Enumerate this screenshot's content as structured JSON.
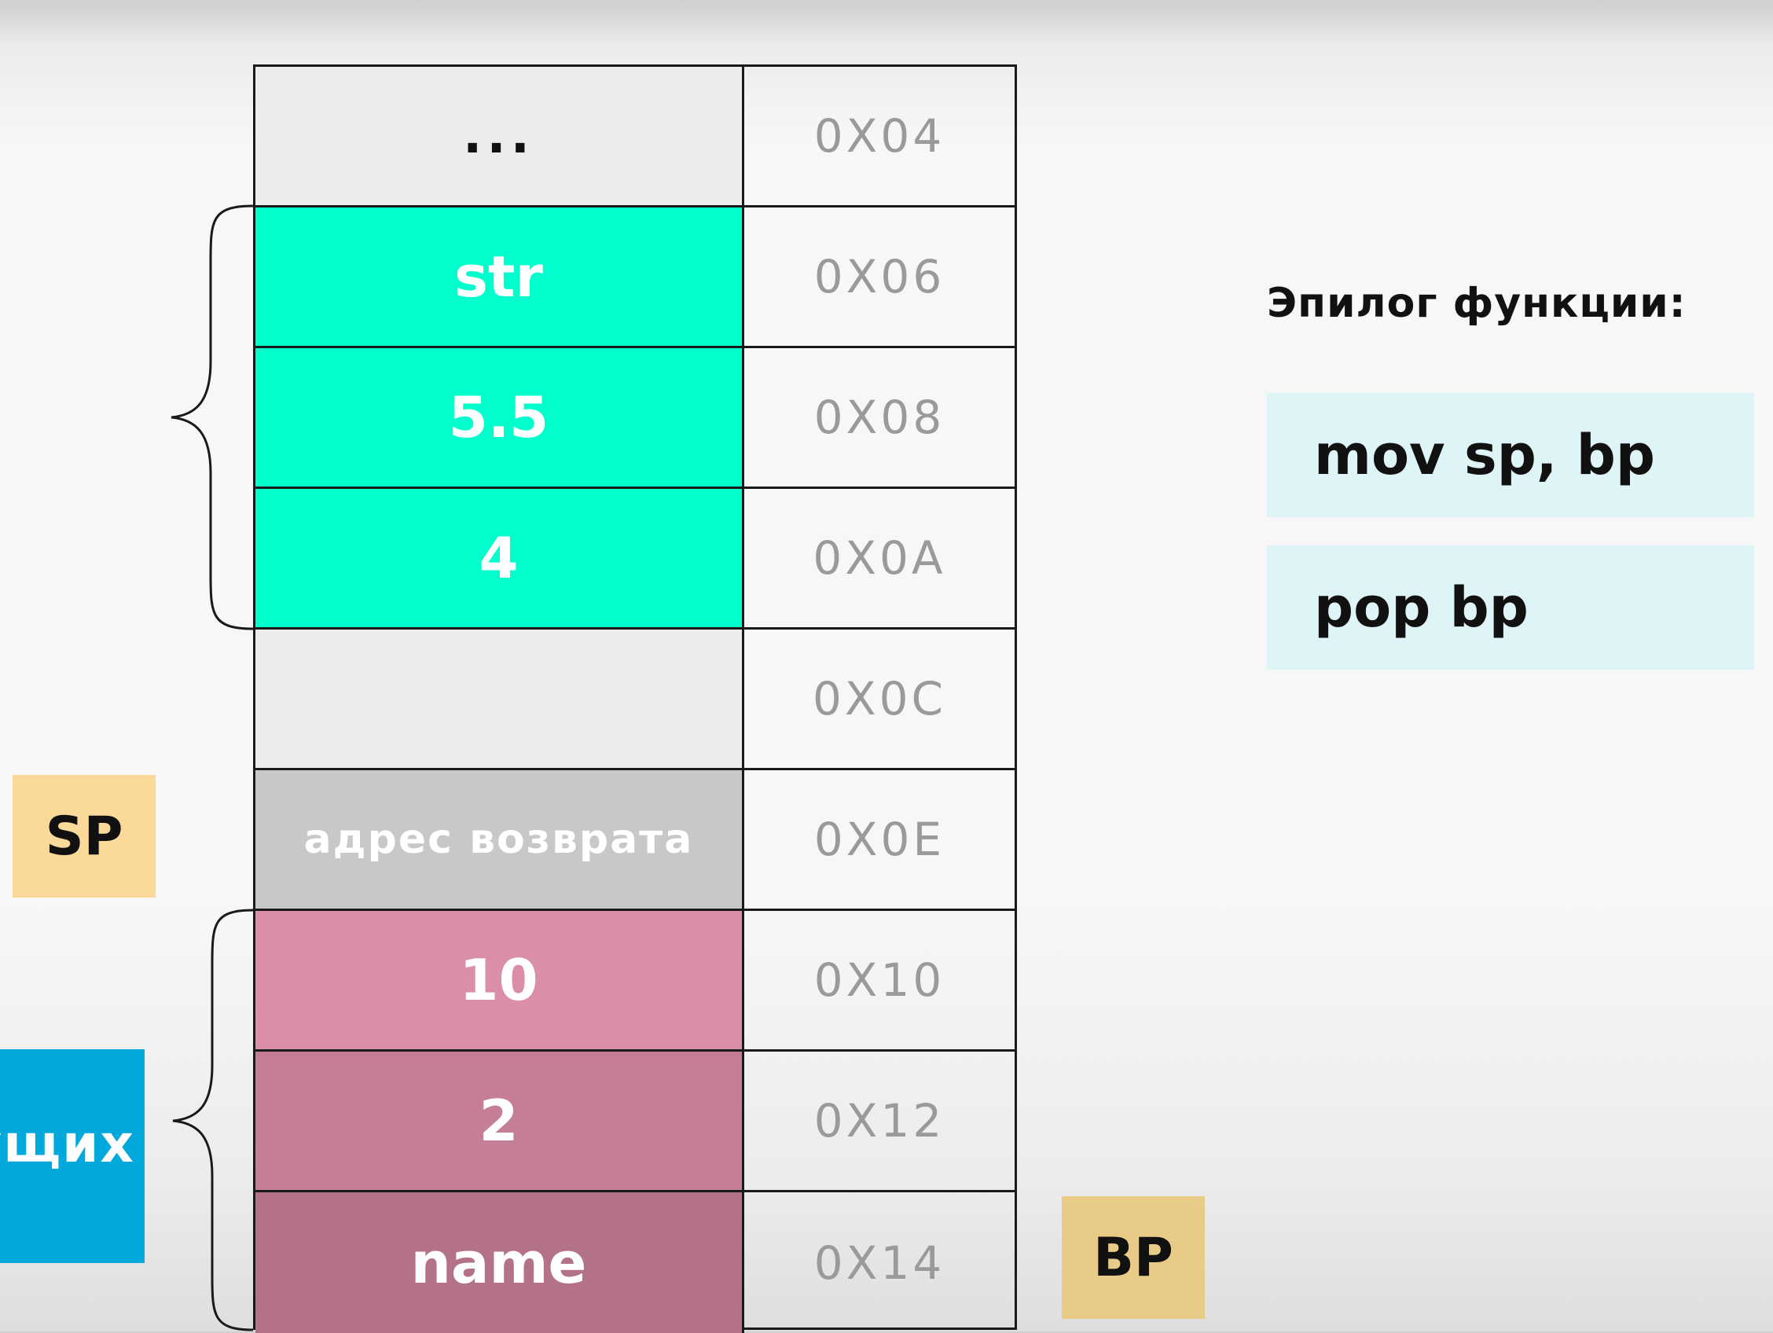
{
  "stack": {
    "rows": [
      {
        "value": "...",
        "address": "0X04",
        "bg": "#ececec",
        "kind": "dots"
      },
      {
        "value": "str",
        "address": "0X06",
        "bg": "#00ffcc",
        "kind": "normal"
      },
      {
        "value": "5.5",
        "address": "0X08",
        "bg": "#00ffcc",
        "kind": "normal"
      },
      {
        "value": "4",
        "address": "0X0A",
        "bg": "#00ffcc",
        "kind": "normal"
      },
      {
        "value": "",
        "address": "0X0C",
        "bg": "#ececec",
        "kind": "normal"
      },
      {
        "value": "адрес возврата",
        "address": "0X0E",
        "bg": "#c8c8c8",
        "kind": "small"
      },
      {
        "value": "10",
        "address": "0X10",
        "bg": "#da8fa6",
        "kind": "normal"
      },
      {
        "value": "2",
        "address": "0X12",
        "bg": "#c47f94",
        "kind": "normal"
      },
      {
        "value": "name",
        "address": "0X14",
        "bg": "#b37288",
        "kind": "normal"
      }
    ]
  },
  "pointers": {
    "sp": {
      "label": "SP",
      "color": "#fbd999"
    },
    "bp": {
      "label": "BP",
      "color": "#e8cb86"
    }
  },
  "side_label": {
    "text": "ущих",
    "color": "#00a8dc"
  },
  "epilogue": {
    "title": "Эпилог функции:",
    "instructions": [
      "mov sp, bp",
      "pop bp"
    ]
  }
}
